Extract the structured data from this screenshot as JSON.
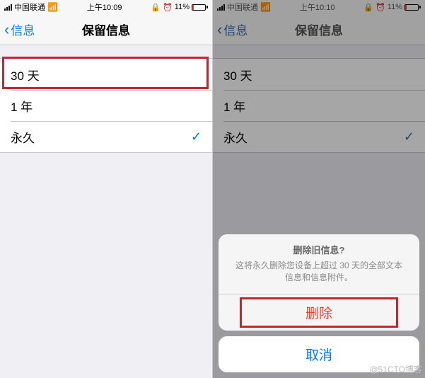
{
  "left": {
    "status": {
      "carrier": "中国联通",
      "time": "上午10:09",
      "battery_pct": "11%"
    },
    "nav": {
      "back": "信息",
      "title": "保留信息"
    },
    "options": {
      "o1": "30 天",
      "o2": "1 年",
      "o3": "永久"
    }
  },
  "right": {
    "status": {
      "carrier": "中国联通",
      "time": "上午10:10",
      "battery_pct": "11%"
    },
    "nav": {
      "back": "信息",
      "title": "保留信息"
    },
    "options": {
      "o1": "30 天",
      "o2": "1 年",
      "o3": "永久"
    },
    "sheet": {
      "title": "删除旧信息?",
      "body": "这将永久删除您设备上超过 30 天的全部文本信息和信息附件。",
      "delete": "删除",
      "cancel": "取消"
    }
  },
  "watermark": "@51CTO博客"
}
